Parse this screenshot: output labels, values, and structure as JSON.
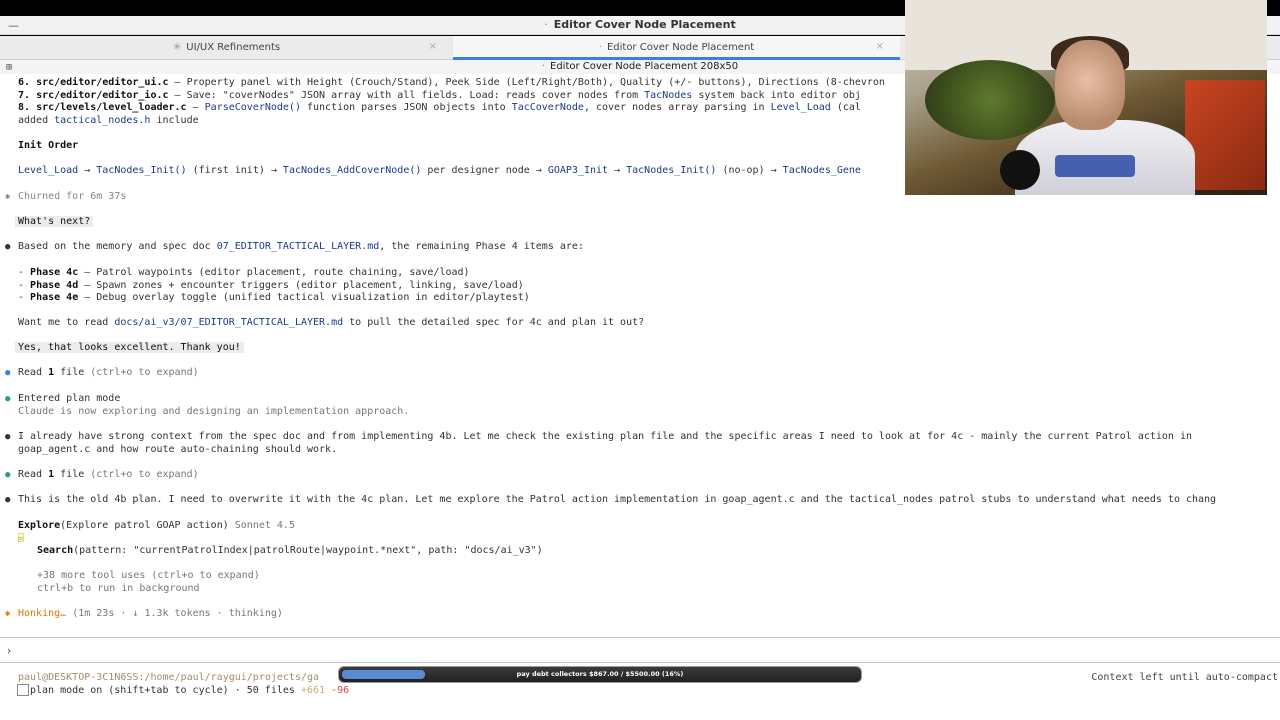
{
  "window": {
    "title": "Editor Cover Node Placement"
  },
  "tabs": [
    {
      "label": "UI/UX Refinements",
      "close": "×"
    },
    {
      "label": "Editor Cover Node Placement",
      "close": "×"
    }
  ],
  "pane": {
    "title": "Editor Cover Node Placement 208x50"
  },
  "lines": {
    "l6a": "6. ",
    "l6f": "src/editor/editor_ui.c",
    "l6b": " — Property panel with Height (Crouch/Stand), Peek Side (Left/Right/Both), Quality (+/- buttons), Directions (8-chevron",
    "l7a": "7. ",
    "l7f": "src/editor/editor_io.c",
    "l7b": " — Save: \"coverNodes\" JSON array with all fields. Load: reads cover nodes from ",
    "l7k": "TacNodes",
    "l7c": " system back into editor obj",
    "l8a": "8. ",
    "l8f": "src/levels/level_loader.c",
    "l8b": " — ",
    "l8k1": "ParseCoverNode()",
    "l8c": " function parses JSON objects into ",
    "l8k2": "TacCoverNode",
    "l8d": ", cover nodes array parsing in ",
    "l8k3": "Level_Load",
    "l8e": " (cal",
    "l9a": "added ",
    "l9k": "tactical_nodes.h",
    "l9b": " include",
    "initOrder": "Init Order",
    "initSeq": [
      {
        "t": "Level_Load",
        "k": true
      },
      {
        "t": " → ",
        "k": false
      },
      {
        "t": "TacNodes_Init()",
        "k": true
      },
      {
        "t": " (first init) → ",
        "k": false
      },
      {
        "t": "TacNodes_AddCoverNode()",
        "k": true
      },
      {
        "t": " per designer node → ",
        "k": false
      },
      {
        "t": "GOAP3_Init",
        "k": true
      },
      {
        "t": " → ",
        "k": false
      },
      {
        "t": "TacNodes_Init()",
        "k": true
      },
      {
        "t": " (no-op) → ",
        "k": false
      },
      {
        "t": "TacNodes_Gene",
        "k": true
      }
    ],
    "churned": "Churned for 6m 37s",
    "whatsNext": "What's next?",
    "basedA": "Based on the memory and spec doc ",
    "basedK": "07_EDITOR_TACTICAL_LAYER.md",
    "basedB": ", the remaining Phase 4 items are:",
    "phases": [
      {
        "dash": "- ",
        "name": "Phase 4c",
        "desc": " — Patrol waypoints (editor placement, route chaining, save/load)"
      },
      {
        "dash": "- ",
        "name": "Phase 4d",
        "desc": " — Spawn zones + encounter triggers (editor placement, linking, save/load)"
      },
      {
        "dash": "- ",
        "name": "Phase 4e",
        "desc": " — Debug overlay toggle (unified tactical visualization in editor/playtest)"
      }
    ],
    "wantA": "Want me to read ",
    "wantK": "docs/ai_v3/07_EDITOR_TACTICAL_LAYER.md",
    "wantB": " to pull the detailed spec for 4c and plan it out?",
    "userMsg": "Yes, that looks excellent. Thank you!",
    "read1": "Read ",
    "read1b": "1",
    "read1c": " file ",
    "read1d": "(ctrl+o to expand)",
    "planMode": "Entered plan mode",
    "planModeSub": "Claude is now exploring and designing an implementation approach.",
    "already1": "I already have strong context from the spec doc and from implementing 4b. Let me check the existing plan file and the specific areas I need to look at for 4c - mainly the current Patrol action in",
    "already2": "goap_agent.c and how route auto-chaining should work.",
    "old4b": "This is the old 4b plan. I need to overwrite it with the 4c plan. Let me explore the Patrol action implementation in goap_agent.c and the tactical_nodes patrol stubs to understand what needs to chang",
    "exploreA": "Explore",
    "exploreB": "(Explore patrol GOAP action)",
    "exploreC": " Sonnet 4.5",
    "searchA": "Search",
    "searchB": "(pattern: \"currentPatrolIndex|patrolRoute|waypoint.*next\", path: \"docs/ai_v3\")",
    "more": "+38 more tool uses (ctrl+o to expand)",
    "ctrlb": "ctrl+b to run in background",
    "honking": "Honking…",
    "honkingB": " (1m 23s · ↓ 1.3k tokens · thinking)",
    "prompt": "›"
  },
  "status": {
    "path": "paul@DESKTOP-3C1N6SS:/home/paul/raygui/projects/ga",
    "context": "Context left until auto-compact",
    "planMode": "plan mode on (shift+tab to cycle) · 50 files ",
    "plus": "+661",
    "minus": "-96"
  },
  "overlay": {
    "text": "pay debt collectors $867.00 / $5500.00 (16%)",
    "progress": 0.16
  },
  "colors": {
    "accent": "#3b7ee8",
    "keyword": "#1b3a8a",
    "thinking": "#d97706"
  }
}
